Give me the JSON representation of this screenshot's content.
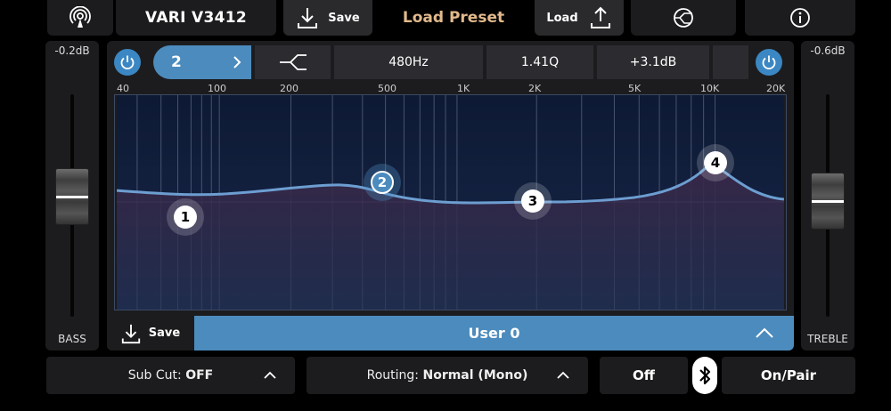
{
  "top": {
    "device_name": "VARI V3412",
    "save_label": "Save",
    "load_preset_label": "Load Preset",
    "load_label": "Load"
  },
  "bass": {
    "level": "-0.2dB",
    "label": "BASS"
  },
  "treble": {
    "level": "-0.6dB",
    "label": "TREBLE"
  },
  "band": {
    "number": "2",
    "frequency": "480Hz",
    "q": "1.41Q",
    "gain": "+3.1dB"
  },
  "freq_axis": [
    "40",
    "100",
    "200",
    "500",
    "1K",
    "2K",
    "5K",
    "10K",
    "20K"
  ],
  "nodes": [
    "1",
    "2",
    "3",
    "4"
  ],
  "eq_footer": {
    "save_label": "Save",
    "preset_name": "User 0"
  },
  "bottom": {
    "sub_cut_label": "Sub Cut:",
    "sub_cut_value": "OFF",
    "routing_label": "Routing:",
    "routing_value": "Normal (Mono)",
    "bt_off_label": "Off",
    "bt_pair_label": "On/Pair"
  },
  "colors": {
    "accent": "#4c8bbd",
    "preset_text": "#e2b98c",
    "panel": "#1c1c1e"
  }
}
